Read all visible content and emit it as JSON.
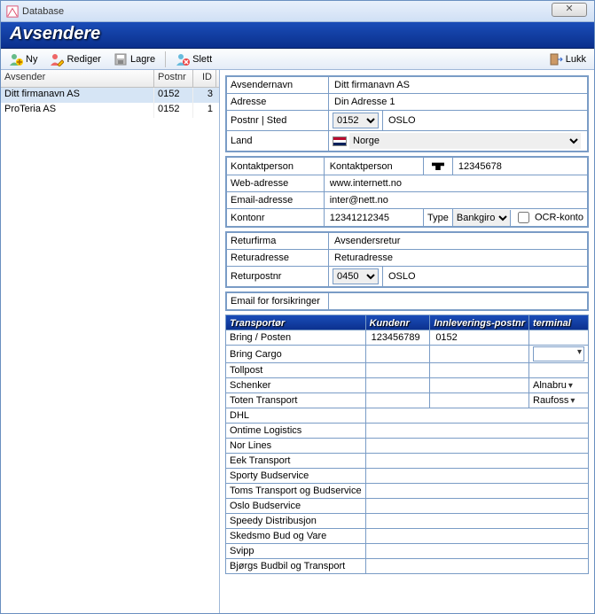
{
  "window": {
    "title": "Database",
    "close": "✕"
  },
  "header": "Avsendere",
  "toolbar": {
    "ny": "Ny",
    "rediger": "Rediger",
    "lagre": "Lagre",
    "slett": "Slett",
    "lukk": "Lukk"
  },
  "list": {
    "col_avsender": "Avsender",
    "col_postnr": "Postnr",
    "col_id": "ID",
    "rows": [
      {
        "avsender": "Ditt firmanavn AS",
        "postnr": "0152",
        "id": "3"
      },
      {
        "avsender": "ProTeria AS",
        "postnr": "0152",
        "id": "1"
      }
    ]
  },
  "form": {
    "avsendernavn_lbl": "Avsendernavn",
    "avsendernavn": "Ditt firmanavn AS",
    "adresse_lbl": "Adresse",
    "adresse": "Din Adresse 1",
    "postnr_lbl": "Postnr | Sted",
    "postnr": "0152",
    "sted": "OSLO",
    "land_lbl": "Land",
    "land": "Norge",
    "kontaktperson_lbl": "Kontaktperson",
    "kontaktperson": "Kontaktperson",
    "telefon": "12345678",
    "web_lbl": "Web-adresse",
    "web": "www.internett.no",
    "email_lbl": "Email-adresse",
    "email": "inter@nett.no",
    "kontonr_lbl": "Kontonr",
    "kontonr": "12341212345",
    "type_lbl": "Type",
    "type": "Bankgiro",
    "ocr_lbl": "OCR-konto",
    "returfirma_lbl": "Returfirma",
    "returfirma": "Avsendersretur",
    "returadresse_lbl": "Returadresse",
    "returadresse": "Returadresse",
    "returpostnr_lbl": "Returpostnr",
    "returpostnr": "0450",
    "retursted": "OSLO",
    "email_forsikring_lbl": "Email for forsikringer",
    "email_forsikring": ""
  },
  "transport": {
    "col_transportor": "Transportør",
    "col_kundenr": "Kundenr",
    "col_postnr": "Innleverings-postnr",
    "col_terminal": "terminal",
    "rows": [
      {
        "name": "Bring / Posten",
        "kundenr": "123456789",
        "postnr": "0152",
        "terminal": ""
      },
      {
        "name": "Bring Cargo",
        "kundenr": "",
        "postnr": "",
        "terminal": "",
        "drop": true
      },
      {
        "name": "Tollpost",
        "kundenr": "",
        "postnr": "",
        "terminal": ""
      },
      {
        "name": "Schenker",
        "kundenr": "",
        "postnr": "",
        "terminal": "Alnabru",
        "tdrop": true
      },
      {
        "name": "Toten Transport",
        "kundenr": "",
        "postnr": "",
        "terminal": "Raufoss",
        "tdrop": true
      },
      {
        "name": "DHL"
      },
      {
        "name": "Ontime Logistics"
      },
      {
        "name": "Nor Lines"
      },
      {
        "name": "Eek Transport"
      },
      {
        "name": "Sporty Budservice"
      },
      {
        "name": "Toms Transport og Budservice"
      },
      {
        "name": "Oslo Budservice"
      },
      {
        "name": "Speedy Distribusjon"
      },
      {
        "name": "Skedsmo Bud og Vare"
      },
      {
        "name": "Svipp"
      },
      {
        "name": "Bjørgs Budbil og Transport"
      }
    ]
  }
}
